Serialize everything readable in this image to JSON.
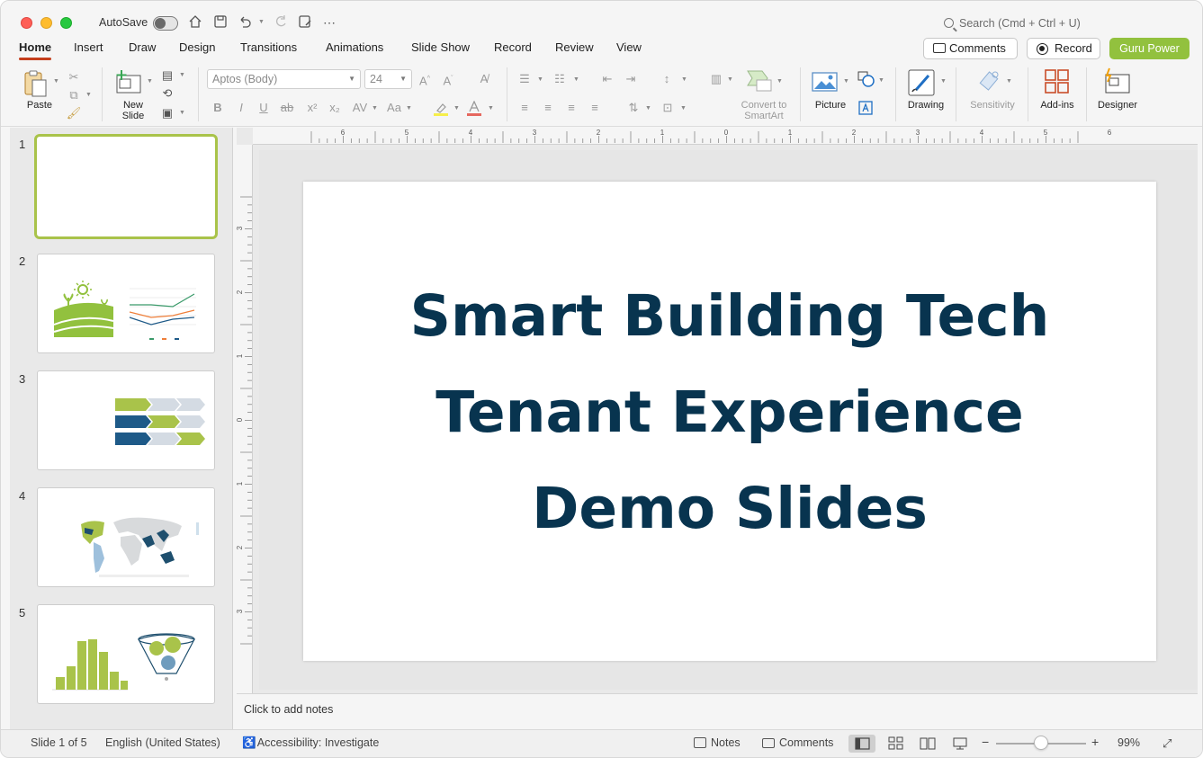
{
  "titlebar": {
    "autosave_label": "AutoSave",
    "search_placeholder": "Search (Cmd + Ctrl + U)"
  },
  "tabs": [
    {
      "label": "Home",
      "active": true
    },
    {
      "label": "Insert"
    },
    {
      "label": "Draw"
    },
    {
      "label": "Design"
    },
    {
      "label": "Transitions"
    },
    {
      "label": "Animations"
    },
    {
      "label": "Slide Show"
    },
    {
      "label": "Record"
    },
    {
      "label": "Review"
    },
    {
      "label": "View"
    }
  ],
  "actions": {
    "comments_label": "Comments",
    "record_label": "Record",
    "guru_label": "Guru Power"
  },
  "ribbon": {
    "paste": "Paste",
    "new_slide": "New\nSlide",
    "font_name": "Aptos (Body)",
    "font_size": "24",
    "convert_smartart": "Convert to\nSmartArt",
    "picture": "Picture",
    "drawing": "Drawing",
    "sensitivity": "Sensitivity",
    "addins": "Add-ins",
    "designer": "Designer"
  },
  "thumbnails": [
    {
      "number": "1"
    },
    {
      "number": "2"
    },
    {
      "number": "3"
    },
    {
      "number": "4"
    },
    {
      "number": "5"
    }
  ],
  "slide": {
    "lines": [
      "Smart Building Tech",
      "Tenant Experience",
      "Demo Slides"
    ]
  },
  "ruler": {
    "h": [
      "6",
      "5",
      "4",
      "3",
      "2",
      "1",
      "0",
      "1",
      "2",
      "3",
      "4",
      "5",
      "6"
    ],
    "v": [
      "3",
      "2",
      "1",
      "0",
      "1",
      "2",
      "3"
    ]
  },
  "notes": {
    "placeholder": "Click to add notes"
  },
  "status": {
    "slide_counter": "Slide 1 of 5",
    "language": "English (United States)",
    "accessibility": "Accessibility: Investigate",
    "notes_label": "Notes",
    "comments_label": "Comments",
    "zoom_value": "99%"
  },
  "colors": {
    "title": "#08344f",
    "accent_green": "#92c13e",
    "tab_underline": "#c43e1c"
  }
}
